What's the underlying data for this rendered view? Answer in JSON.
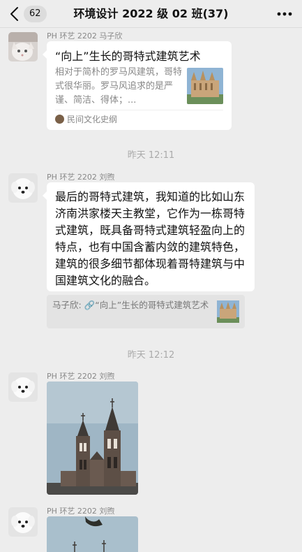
{
  "header": {
    "unread_count": "62",
    "title": "环境设计 2022 级 02 班(37)"
  },
  "messages": [
    {
      "sender": "PH 环艺 2202 马子欣",
      "card": {
        "title": "“向上”生长的哥特式建筑艺术",
        "description": "相对于简朴的罗马风建筑，哥特式很华丽。罗马风追求的是严谨、简洁、得体；...",
        "source": "民间文化史纲"
      }
    },
    {
      "time": "昨天 12:11"
    },
    {
      "sender": "PH 环艺 2202 刘煦",
      "text": "最后的哥特式建筑，我知道的比如山东济南洪家楼天主教堂，它作为一栋哥特式建筑，既具备哥特式建筑轻盈向上的特点，也有中国含蓄内敛的建筑特色，建筑的很多细节都体现着哥特建筑与中国建筑文化的融合。",
      "quote": "马子欣: 🔗“向上”生长的哥特式建筑艺术"
    },
    {
      "time": "昨天 12:12"
    },
    {
      "sender": "PH 环艺 2202 刘煦"
    },
    {
      "sender": "PH 环艺 2202 刘煦"
    }
  ],
  "icons": {
    "back": "chevron-left-icon",
    "more": "ellipsis-icon",
    "source": "source-avatar-icon"
  },
  "colors": {
    "background": "#ededed",
    "bubble": "#ffffff",
    "secondary_text": "#888888"
  }
}
